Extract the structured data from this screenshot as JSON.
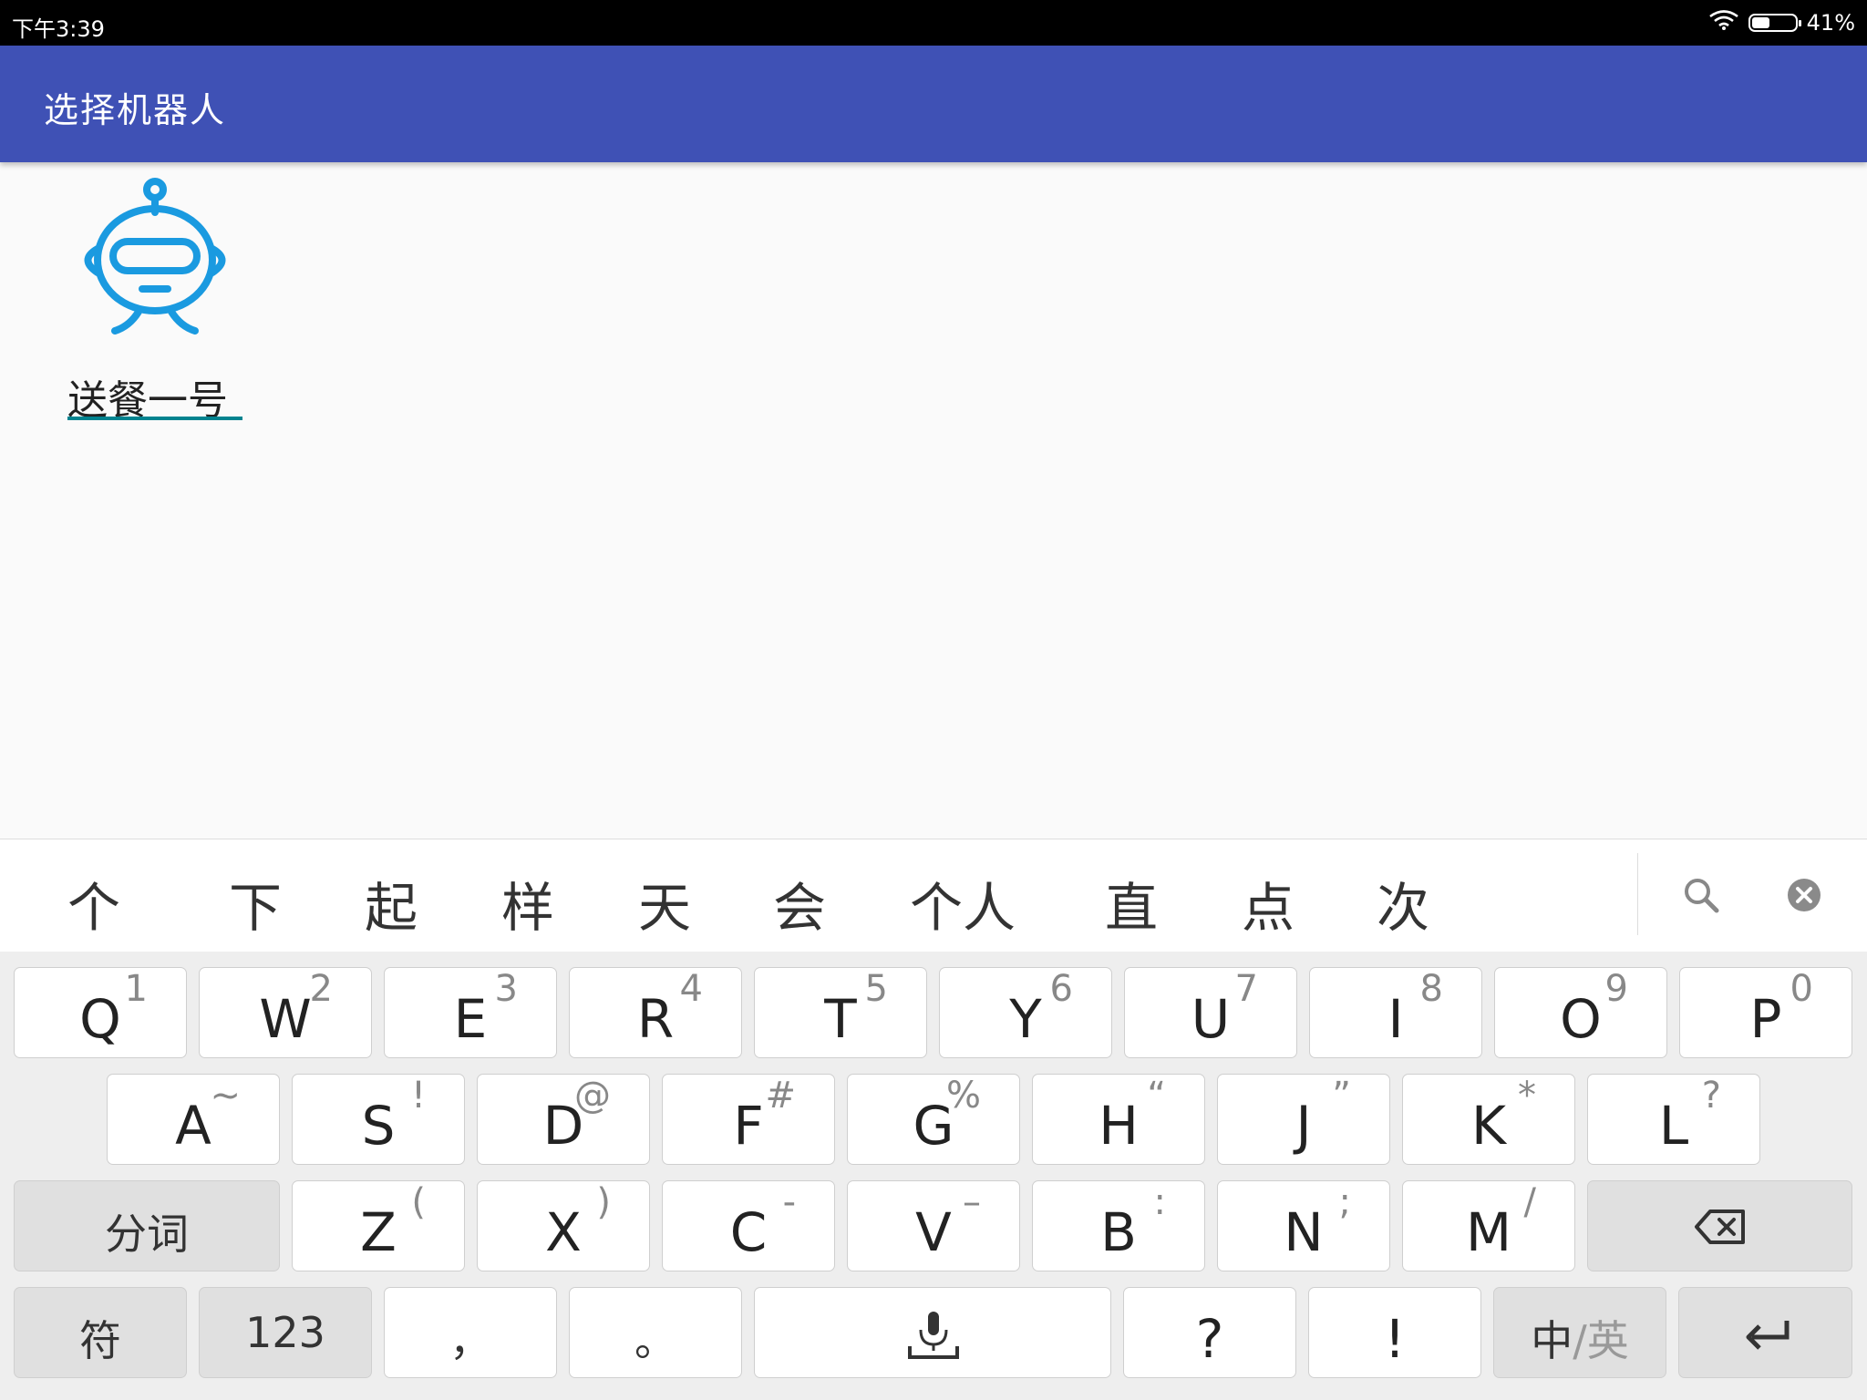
{
  "status_bar": {
    "time": "下午3:39",
    "battery": "41%",
    "battery_level": 0.41
  },
  "app_bar": {
    "title": "选择机器人"
  },
  "robots": [
    {
      "name": "送餐一号",
      "icon": "robot-icon"
    }
  ],
  "candidates": {
    "words": [
      "个",
      "下",
      "起",
      "样",
      "天",
      "会",
      "个人",
      "直",
      "点",
      "次"
    ],
    "search_icon": "search-icon",
    "close_icon": "close-circle-icon"
  },
  "keyboard": {
    "row1": [
      {
        "label": "Q",
        "hint": "1"
      },
      {
        "label": "W",
        "hint": "2"
      },
      {
        "label": "E",
        "hint": "3"
      },
      {
        "label": "R",
        "hint": "4"
      },
      {
        "label": "T",
        "hint": "5"
      },
      {
        "label": "Y",
        "hint": "6"
      },
      {
        "label": "U",
        "hint": "7"
      },
      {
        "label": "I",
        "hint": "8"
      },
      {
        "label": "O",
        "hint": "9"
      },
      {
        "label": "P",
        "hint": "0"
      }
    ],
    "row2": [
      {
        "label": "A",
        "hint": "~"
      },
      {
        "label": "S",
        "hint": "!"
      },
      {
        "label": "D",
        "hint": "@"
      },
      {
        "label": "F",
        "hint": "#"
      },
      {
        "label": "G",
        "hint": "%"
      },
      {
        "label": "H",
        "hint": "“"
      },
      {
        "label": "J",
        "hint": "”"
      },
      {
        "label": "K",
        "hint": "*"
      },
      {
        "label": "L",
        "hint": "?"
      }
    ],
    "row3": [
      {
        "label": "Z",
        "hint": "("
      },
      {
        "label": "X",
        "hint": ")"
      },
      {
        "label": "C",
        "hint": "-"
      },
      {
        "label": "V",
        "hint": "–"
      },
      {
        "label": "B",
        "hint": ":"
      },
      {
        "label": "N",
        "hint": ";"
      },
      {
        "label": "M",
        "hint": "/"
      }
    ],
    "segment_label": "分词",
    "symbols_label": "符",
    "numbers_label": "123",
    "comma_label": "，",
    "period_label": "。",
    "question_label": "?",
    "exclaim_label": "!",
    "lang_zh": "中",
    "lang_sep": "/",
    "lang_en": "英",
    "backspace_icon": "backspace-icon",
    "mic_icon": "microphone-icon",
    "enter_icon": "enter-icon"
  }
}
